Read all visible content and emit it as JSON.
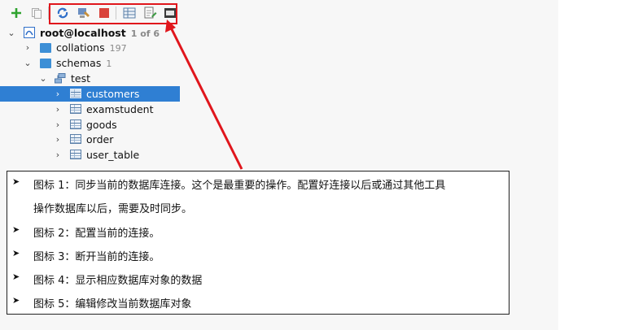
{
  "toolbar": {
    "buttons": [
      {
        "name": "add-icon",
        "tooltip": ""
      },
      {
        "name": "copy-icon",
        "tooltip": ""
      },
      {
        "name": "sync-icon",
        "tooltip": ""
      },
      {
        "name": "configure-icon",
        "tooltip": ""
      },
      {
        "name": "disconnect-icon",
        "tooltip": ""
      },
      {
        "name": "table-data-icon",
        "tooltip": ""
      },
      {
        "name": "edit-object-icon",
        "tooltip": ""
      },
      {
        "name": "console-icon",
        "tooltip": ""
      }
    ],
    "colors": {
      "highlight": "#e0161c",
      "add": "#2fa32f",
      "sync": "#2f6fc9",
      "stop": "#d9433b"
    }
  },
  "tree": {
    "connection": {
      "label": "root@localhost",
      "count": "1 of 6"
    },
    "collations": {
      "label": "collations",
      "count": "197"
    },
    "schemas": {
      "label": "schemas",
      "count": "1"
    },
    "schema_test": {
      "label": "test"
    },
    "tables": [
      {
        "label": "customers",
        "selected": true
      },
      {
        "label": "examstudent",
        "selected": false
      },
      {
        "label": "goods",
        "selected": false
      },
      {
        "label": "order",
        "selected": false
      },
      {
        "label": "user_table",
        "selected": false
      }
    ]
  },
  "notes": [
    {
      "bullet": "➤",
      "text": "图标 1：同步当前的数据库连接。这个是最重要的操作。配置好连接以后或通过其他工具"
    },
    {
      "bullet": "",
      "text": "操作数据库以后，需要及时同步。"
    },
    {
      "bullet": "➤",
      "text": "图标 2：配置当前的连接。"
    },
    {
      "bullet": "➤",
      "text": "图标 3：断开当前的连接。"
    },
    {
      "bullet": "➤",
      "text": "图标 4：显示相应数据库对象的数据"
    },
    {
      "bullet": "➤",
      "text": "图标 5：编辑修改当前数据库对象"
    }
  ]
}
